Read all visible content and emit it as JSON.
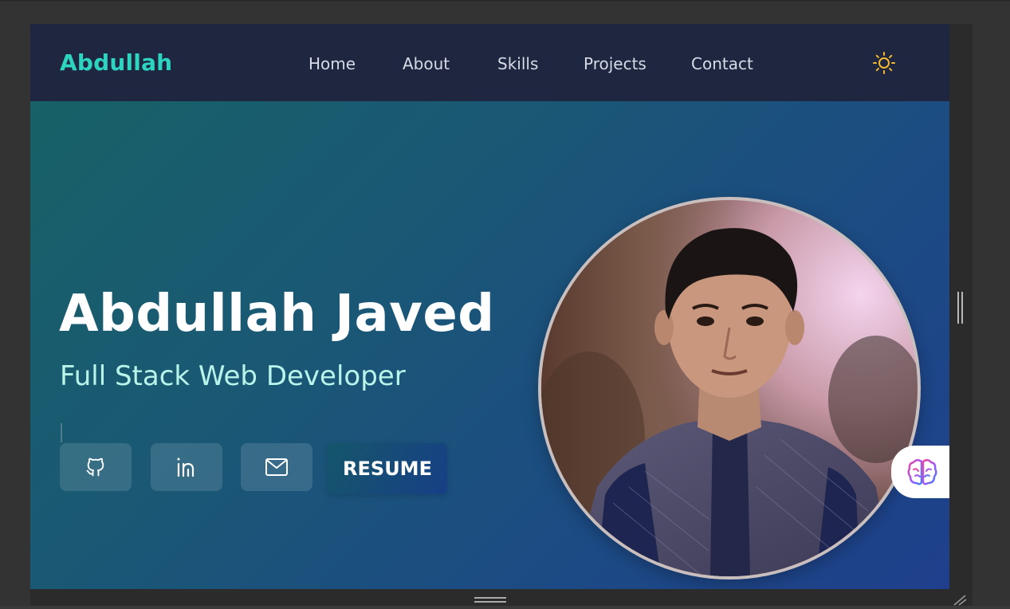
{
  "nav": {
    "brand": "Abdullah",
    "links": [
      "Home",
      "About",
      "Skills",
      "Projects",
      "Contact"
    ],
    "theme_icon": "sun-icon"
  },
  "hero": {
    "name": "Abdullah Javed",
    "role": "Full Stack Web Developer",
    "social_icons": [
      "github-icon",
      "linkedin-icon",
      "mail-icon"
    ],
    "resume_label": "RESUME",
    "photo": "profile-photo"
  },
  "widgets": {
    "assistant_icon": "brain-icon"
  },
  "colors": {
    "brand": "#2dd4bf",
    "nav_bg": "#1e2640",
    "hero_gradient_start": "#176167",
    "hero_gradient_end": "#1f3f8c",
    "role_text": "#b8f4ea",
    "sun": "#f5b82e"
  }
}
